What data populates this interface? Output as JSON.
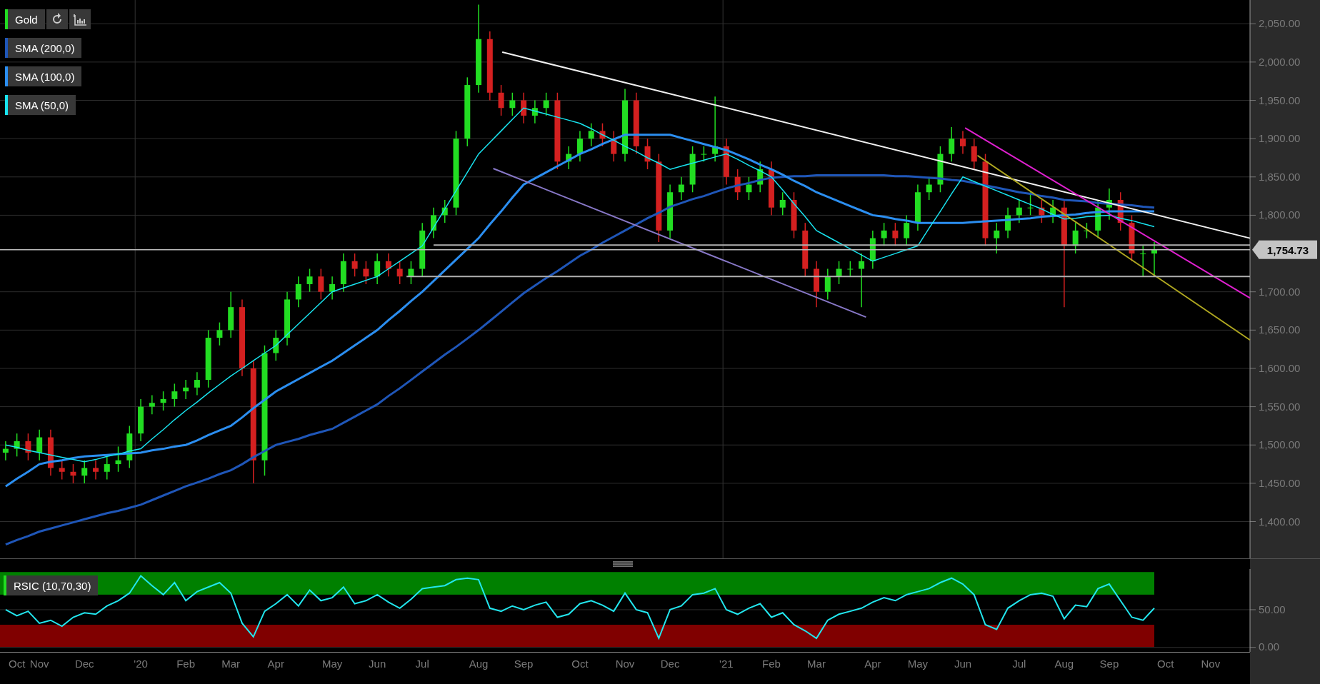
{
  "price_chart": {
    "legend": {
      "label": "Gold",
      "color": "#22dd22"
    },
    "last_price": "1,754.73",
    "chart_data": {
      "type": "candlestick",
      "grid": true,
      "ylim": [
        1352,
        2081
      ],
      "categories": [
        null,
        null,
        null,
        null,
        null,
        null,
        null,
        null,
        null,
        null,
        null,
        null,
        null,
        null,
        null,
        null,
        null,
        null,
        null,
        null,
        null,
        null,
        null,
        null,
        null,
        null,
        null,
        null,
        null,
        null,
        null,
        null,
        null,
        null,
        null,
        null,
        null,
        null,
        null,
        null,
        null,
        null,
        null,
        null,
        null,
        null,
        null,
        null,
        null,
        null,
        null,
        null,
        null,
        null,
        null,
        null,
        null,
        null,
        null,
        null,
        null,
        null,
        null,
        null,
        null,
        null,
        null,
        null,
        null,
        null,
        null,
        null,
        null,
        null,
        null,
        null,
        null,
        null,
        null,
        null,
        null,
        null,
        null,
        null,
        null,
        null,
        null,
        null,
        null,
        null,
        null,
        null,
        null,
        null,
        null,
        null,
        null,
        null,
        null,
        null,
        null,
        null,
        null,
        null,
        null,
        null,
        null,
        null,
        null,
        null,
        null
      ],
      "yticks": [
        {
          "value": 2050,
          "label": "2,050.00"
        },
        {
          "value": 2000,
          "label": "2,000.00"
        },
        {
          "value": 1950,
          "label": "1,950.00"
        },
        {
          "value": 1900,
          "label": "1,900.00"
        },
        {
          "value": 1850,
          "label": "1,850.00"
        },
        {
          "value": 1800,
          "label": "1,800.00"
        },
        {
          "value": 1700,
          "label": "1,700.00"
        },
        {
          "value": 1650,
          "label": "1,650.00"
        },
        {
          "value": 1600,
          "label": "1,600.00"
        },
        {
          "value": 1550,
          "label": "1,550.00"
        },
        {
          "value": 1500,
          "label": "1,500.00"
        },
        {
          "value": 1450,
          "label": "1,450.00"
        },
        {
          "value": 1400,
          "label": "1,400.00"
        }
      ],
      "ohlc": [
        [
          1490,
          1505,
          1480,
          1495
        ],
        [
          1495,
          1515,
          1485,
          1505
        ],
        [
          1505,
          1515,
          1480,
          1490
        ],
        [
          1490,
          1520,
          1480,
          1510
        ],
        [
          1510,
          1520,
          1460,
          1470
        ],
        [
          1470,
          1480,
          1455,
          1465
        ],
        [
          1465,
          1475,
          1450,
          1460
        ],
        [
          1460,
          1480,
          1450,
          1470
        ],
        [
          1470,
          1480,
          1455,
          1465
        ],
        [
          1465,
          1485,
          1455,
          1475
        ],
        [
          1475,
          1498,
          1465,
          1480
        ],
        [
          1480,
          1525,
          1470,
          1515
        ],
        [
          1515,
          1560,
          1505,
          1550
        ],
        [
          1550,
          1565,
          1540,
          1555
        ],
        [
          1555,
          1570,
          1545,
          1560
        ],
        [
          1560,
          1580,
          1550,
          1570
        ],
        [
          1570,
          1585,
          1560,
          1575
        ],
        [
          1575,
          1595,
          1565,
          1585
        ],
        [
          1585,
          1650,
          1575,
          1640
        ],
        [
          1640,
          1660,
          1630,
          1650
        ],
        [
          1650,
          1700,
          1640,
          1680
        ],
        [
          1680,
          1690,
          1590,
          1600
        ],
        [
          1600,
          1610,
          1450,
          1480
        ],
        [
          1480,
          1630,
          1460,
          1620
        ],
        [
          1620,
          1650,
          1610,
          1640
        ],
        [
          1640,
          1700,
          1630,
          1690
        ],
        [
          1690,
          1720,
          1680,
          1710
        ],
        [
          1710,
          1730,
          1700,
          1720
        ],
        [
          1720,
          1730,
          1690,
          1700
        ],
        [
          1700,
          1720,
          1690,
          1710
        ],
        [
          1710,
          1750,
          1700,
          1740
        ],
        [
          1740,
          1750,
          1720,
          1730
        ],
        [
          1730,
          1740,
          1710,
          1720
        ],
        [
          1720,
          1750,
          1710,
          1740
        ],
        [
          1740,
          1750,
          1720,
          1730
        ],
        [
          1730,
          1740,
          1710,
          1720
        ],
        [
          1720,
          1740,
          1710,
          1730
        ],
        [
          1730,
          1790,
          1720,
          1780
        ],
        [
          1780,
          1810,
          1770,
          1800
        ],
        [
          1800,
          1820,
          1790,
          1810
        ],
        [
          1810,
          1910,
          1800,
          1900
        ],
        [
          1900,
          1980,
          1890,
          1970
        ],
        [
          1970,
          2075,
          1960,
          2030
        ],
        [
          2030,
          2040,
          1950,
          1960
        ],
        [
          1960,
          1970,
          1930,
          1940
        ],
        [
          1940,
          1960,
          1930,
          1950
        ],
        [
          1950,
          1960,
          1920,
          1930
        ],
        [
          1930,
          1950,
          1920,
          1940
        ],
        [
          1940,
          1960,
          1930,
          1950
        ],
        [
          1950,
          1960,
          1860,
          1870
        ],
        [
          1870,
          1890,
          1860,
          1880
        ],
        [
          1880,
          1910,
          1870,
          1900
        ],
        [
          1900,
          1920,
          1890,
          1910
        ],
        [
          1910,
          1920,
          1890,
          1900
        ],
        [
          1900,
          1910,
          1870,
          1880
        ],
        [
          1880,
          1965,
          1870,
          1950
        ],
        [
          1950,
          1960,
          1880,
          1890
        ],
        [
          1890,
          1900,
          1860,
          1870
        ],
        [
          1870,
          1880,
          1765,
          1780
        ],
        [
          1780,
          1840,
          1770,
          1830
        ],
        [
          1830,
          1850,
          1820,
          1840
        ],
        [
          1840,
          1890,
          1830,
          1880
        ],
        [
          1880,
          1890,
          1870,
          1880
        ],
        [
          1880,
          1955,
          1870,
          1890
        ],
        [
          1890,
          1900,
          1840,
          1850
        ],
        [
          1850,
          1860,
          1820,
          1830
        ],
        [
          1830,
          1850,
          1820,
          1840
        ],
        [
          1840,
          1870,
          1830,
          1860
        ],
        [
          1860,
          1870,
          1800,
          1810
        ],
        [
          1810,
          1830,
          1800,
          1820
        ],
        [
          1820,
          1830,
          1770,
          1780
        ],
        [
          1780,
          1790,
          1720,
          1730
        ],
        [
          1730,
          1740,
          1680,
          1700
        ],
        [
          1700,
          1730,
          1690,
          1720
        ],
        [
          1720,
          1740,
          1710,
          1730
        ],
        [
          1730,
          1740,
          1720,
          1730
        ],
        [
          1730,
          1750,
          1680,
          1740
        ],
        [
          1740,
          1780,
          1730,
          1770
        ],
        [
          1770,
          1790,
          1760,
          1780
        ],
        [
          1780,
          1790,
          1760,
          1770
        ],
        [
          1770,
          1800,
          1760,
          1790
        ],
        [
          1790,
          1840,
          1780,
          1830
        ],
        [
          1830,
          1850,
          1820,
          1840
        ],
        [
          1840,
          1890,
          1830,
          1880
        ],
        [
          1880,
          1915,
          1870,
          1900
        ],
        [
          1900,
          1910,
          1880,
          1890
        ],
        [
          1890,
          1900,
          1860,
          1870
        ],
        [
          1870,
          1880,
          1760,
          1770
        ],
        [
          1770,
          1790,
          1750,
          1780
        ],
        [
          1780,
          1810,
          1770,
          1800
        ],
        [
          1800,
          1820,
          1790,
          1810
        ],
        [
          1810,
          1830,
          1800,
          1810
        ],
        [
          1810,
          1820,
          1790,
          1800
        ],
        [
          1800,
          1820,
          1790,
          1810
        ],
        [
          1810,
          1820,
          1680,
          1760
        ],
        [
          1760,
          1790,
          1750,
          1780
        ],
        [
          1780,
          1790,
          1770,
          1780
        ],
        [
          1780,
          1820,
          1770,
          1810
        ],
        [
          1810,
          1835,
          1794,
          1820
        ],
        [
          1820,
          1830,
          1780,
          1790
        ],
        [
          1790,
          1800,
          1740,
          1750
        ],
        [
          1750,
          1760,
          1720,
          1750
        ],
        [
          1750,
          1765,
          1720,
          1755
        ],
        null,
        null,
        null,
        null,
        null,
        null,
        null,
        null
      ],
      "series": [
        {
          "name": "SMA (200,0)",
          "type": "line",
          "color": "#1f56b8",
          "values": [
            1370,
            1376,
            1381,
            1387,
            1391,
            1395,
            1399,
            1403,
            1407,
            1411,
            1414,
            1418,
            1422,
            1428,
            1434,
            1440,
            1446,
            1451,
            1456,
            1462,
            1467,
            1475,
            1484,
            1492,
            1500,
            1504,
            1508,
            1513,
            1517,
            1521,
            1529,
            1537,
            1545,
            1553,
            1564,
            1574,
            1585,
            1596,
            1607,
            1618,
            1628,
            1639,
            1650,
            1662,
            1674,
            1686,
            1698,
            1708,
            1718,
            1727,
            1737,
            1747,
            1755,
            1764,
            1772,
            1780,
            1788,
            1796,
            1803,
            1811,
            1816,
            1821,
            1825,
            1830,
            1835,
            1839,
            1842,
            1846,
            1849,
            1850,
            1851,
            1851,
            1852,
            1852,
            1852,
            1852,
            1852,
            1852,
            1852,
            1851,
            1851,
            1850,
            1849,
            1848,
            1846,
            1845,
            1842,
            1839,
            1836,
            1833,
            1830,
            1828,
            1825,
            1823,
            1820,
            1819,
            1818,
            1816,
            1815,
            1814,
            1813,
            1811,
            1810,
            null,
            null,
            null,
            null,
            null,
            null,
            null,
            null
          ]
        },
        {
          "name": "SMA (100,0)",
          "type": "line",
          "color": "#2b8ef0",
          "values": [
            1446,
            1456,
            1465,
            1475,
            1478,
            1480,
            1483,
            1485,
            1486,
            1487,
            1488,
            1489,
            1490,
            1493,
            1495,
            1498,
            1500,
            1506,
            1513,
            1519,
            1525,
            1536,
            1548,
            1559,
            1570,
            1578,
            1586,
            1594,
            1602,
            1610,
            1620,
            1630,
            1640,
            1650,
            1663,
            1675,
            1688,
            1700,
            1714,
            1728,
            1742,
            1756,
            1770,
            1788,
            1805,
            1823,
            1840,
            1848,
            1856,
            1864,
            1872,
            1880,
            1886,
            1893,
            1899,
            1905,
            1905,
            1905,
            1905,
            1905,
            1901,
            1897,
            1893,
            1889,
            1885,
            1879,
            1873,
            1866,
            1860,
            1853,
            1845,
            1838,
            1830,
            1824,
            1818,
            1812,
            1806,
            1800,
            1798,
            1795,
            1793,
            1790,
            1790,
            1790,
            1790,
            1790,
            1791,
            1792,
            1793,
            1794,
            1795,
            1796,
            1798,
            1799,
            1800,
            1801,
            1803,
            1804,
            1805,
            1805,
            1805,
            1805,
            1805,
            null,
            null,
            null,
            null,
            null,
            null,
            null,
            null
          ]
        },
        {
          "name": "SMA (50,0)",
          "type": "line",
          "color": "#18e4f0",
          "values": [
            1500,
            1497,
            1493,
            1490,
            1487,
            1484,
            1481,
            1478,
            1481,
            1485,
            1488,
            1492,
            1495,
            1508,
            1520,
            1533,
            1545,
            1556,
            1568,
            1579,
            1590,
            1600,
            1610,
            1620,
            1630,
            1644,
            1658,
            1672,
            1686,
            1700,
            1705,
            1710,
            1715,
            1720,
            1730,
            1740,
            1750,
            1760,
            1784,
            1808,
            1832,
            1856,
            1880,
            1895,
            1910,
            1925,
            1940,
            1936,
            1932,
            1928,
            1924,
            1920,
            1913,
            1905,
            1898,
            1890,
            1883,
            1875,
            1868,
            1860,
            1864,
            1868,
            1872,
            1876,
            1880,
            1873,
            1865,
            1858,
            1850,
            1833,
            1815,
            1798,
            1780,
            1772,
            1764,
            1756,
            1748,
            1740,
            1745,
            1750,
            1755,
            1760,
            1783,
            1805,
            1828,
            1850,
            1844,
            1838,
            1832,
            1826,
            1820,
            1814,
            1808,
            1801,
            1795,
            1796,
            1798,
            1799,
            1800,
            1796,
            1793,
            1789,
            1785,
            null,
            null,
            null,
            null,
            null,
            null,
            null,
            null
          ]
        }
      ]
    }
  },
  "rsi_chart": {
    "legend": {
      "color": "#22dd22"
    },
    "chart_data": {
      "type": "line",
      "grid": true,
      "ylim": [
        -6,
        104
      ],
      "yticks": [
        {
          "value": 50,
          "label": "50.00"
        },
        {
          "value": 0,
          "label": "0.00"
        }
      ],
      "categories": [
        null,
        "Oct",
        null,
        "Nov",
        null,
        null,
        null,
        "Dec",
        null,
        null,
        null,
        null,
        "'20",
        null,
        null,
        null,
        "Feb",
        null,
        null,
        null,
        "Mar",
        null,
        null,
        null,
        "Apr",
        null,
        null,
        null,
        null,
        "May",
        null,
        null,
        null,
        "Jun",
        null,
        null,
        null,
        "Jul",
        null,
        null,
        null,
        null,
        "Aug",
        null,
        null,
        null,
        "Sep",
        null,
        null,
        null,
        null,
        "Oct",
        null,
        null,
        null,
        "Nov",
        null,
        null,
        null,
        "Dec",
        null,
        null,
        null,
        null,
        "'21",
        null,
        null,
        null,
        "Feb",
        null,
        null,
        null,
        "Mar",
        null,
        null,
        null,
        null,
        "Apr",
        null,
        null,
        null,
        "May",
        null,
        null,
        null,
        "Jun",
        null,
        null,
        null,
        null,
        "Jul",
        null,
        null,
        null,
        "Aug",
        null,
        null,
        null,
        "Sep",
        null,
        null,
        null,
        null,
        "Oct",
        null,
        null,
        null,
        "Nov",
        null,
        null,
        null
      ],
      "bands": [
        {
          "axis": "y",
          "from": 70,
          "to": 100,
          "color": "#008000"
        },
        {
          "axis": "y",
          "from": 0,
          "to": 30,
          "color": "#800000"
        }
      ],
      "series": [
        {
          "name": "RSIC (10,70,30)",
          "color": "#22e6ee",
          "values": [
            50,
            42,
            48,
            32,
            36,
            28,
            40,
            46,
            44,
            55,
            62,
            72,
            95,
            82,
            70,
            86,
            62,
            74,
            80,
            86,
            72,
            32,
            14,
            48,
            58,
            70,
            55,
            76,
            62,
            66,
            80,
            58,
            62,
            70,
            60,
            52,
            64,
            78,
            80,
            82,
            90,
            92,
            90,
            52,
            48,
            55,
            50,
            56,
            60,
            40,
            44,
            58,
            62,
            56,
            48,
            72,
            50,
            46,
            12,
            50,
            55,
            70,
            72,
            78,
            50,
            44,
            52,
            58,
            40,
            46,
            30,
            22,
            12,
            36,
            44,
            48,
            52,
            60,
            66,
            62,
            70,
            74,
            78,
            86,
            92,
            84,
            70,
            30,
            24,
            52,
            62,
            70,
            72,
            68,
            38,
            56,
            54,
            78,
            84,
            62,
            40,
            36,
            52,
            null,
            null,
            null,
            null,
            null,
            null,
            null,
            null
          ]
        }
      ]
    }
  }
}
